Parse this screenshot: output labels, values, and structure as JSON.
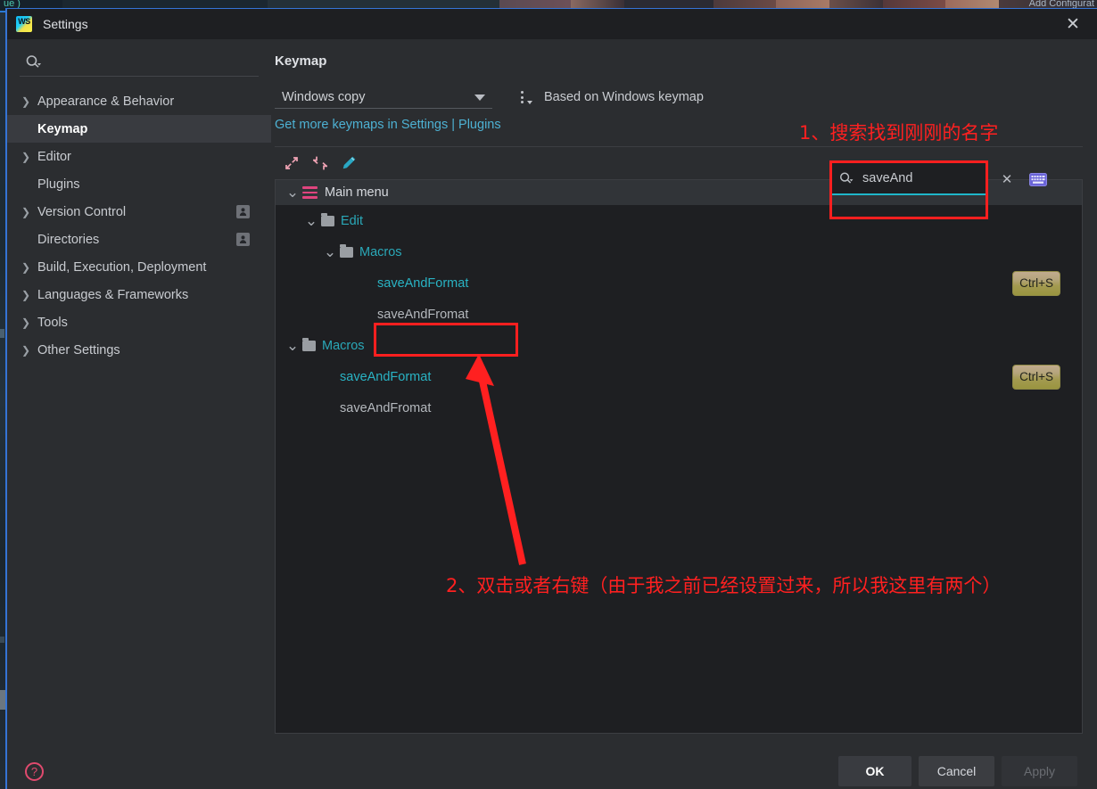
{
  "background": {
    "left_code": "ue )",
    "right_label": "Add Configurat"
  },
  "window": {
    "title": "Settings",
    "app_icon": "webstorm-icon",
    "close_icon": "close-icon"
  },
  "sidebar": {
    "search_icon": "search-icon",
    "search_placeholder": "",
    "items": [
      {
        "label": "Appearance & Behavior",
        "expandable": true,
        "selected": false,
        "badge": false
      },
      {
        "label": "Keymap",
        "expandable": false,
        "selected": true,
        "badge": false
      },
      {
        "label": "Editor",
        "expandable": true,
        "selected": false,
        "badge": false
      },
      {
        "label": "Plugins",
        "expandable": false,
        "selected": false,
        "badge": false
      },
      {
        "label": "Version Control",
        "expandable": true,
        "selected": false,
        "badge": true
      },
      {
        "label": "Directories",
        "expandable": false,
        "selected": false,
        "badge": true
      },
      {
        "label": "Build, Execution, Deployment",
        "expandable": true,
        "selected": false,
        "badge": false
      },
      {
        "label": "Languages & Frameworks",
        "expandable": true,
        "selected": false,
        "badge": false
      },
      {
        "label": "Tools",
        "expandable": true,
        "selected": false,
        "badge": false
      },
      {
        "label": "Other Settings",
        "expandable": true,
        "selected": false,
        "badge": false
      }
    ]
  },
  "content": {
    "page_title": "Keymap",
    "keymap_selected": "Windows copy",
    "kebab_icon": "more-options-icon",
    "based_on": "Based on Windows keymap",
    "get_more_link": "Get more keymaps in Settings | Plugins",
    "toolbar": {
      "expand_all_icon": "expand-all-icon",
      "collapse_all_icon": "collapse-all-icon",
      "edit_icon": "edit-pencil-icon"
    },
    "search": {
      "icon": "search-filter-icon",
      "value": "saveAnd",
      "clear_icon": "clear-x-icon",
      "keyboard_icon": "keyboard-shortcut-icon"
    }
  },
  "tree": {
    "rows": [
      {
        "label": "Main menu",
        "indent": 0,
        "icon": "hamburger-icon",
        "twisty": "down",
        "style": "white",
        "header": true,
        "shortcut": ""
      },
      {
        "label": "Edit",
        "indent": 1,
        "icon": "folder-icon",
        "twisty": "down",
        "style": "cyan",
        "header": false,
        "shortcut": ""
      },
      {
        "label": "Macros",
        "indent": 2,
        "icon": "folder-icon",
        "twisty": "down",
        "style": "cyan",
        "header": false,
        "shortcut": ""
      },
      {
        "label": "saveAndFormat",
        "indent": 4,
        "icon": "none",
        "twisty": "none",
        "style": "cyan-b",
        "header": false,
        "shortcut": "Ctrl+S"
      },
      {
        "label": "saveAndFromat",
        "indent": 4,
        "icon": "none",
        "twisty": "none",
        "style": "gray",
        "header": false,
        "shortcut": ""
      },
      {
        "label": "Macros",
        "indent": 0,
        "icon": "folder-icon",
        "twisty": "down",
        "style": "cyan",
        "header": false,
        "shortcut": ""
      },
      {
        "label": "saveAndFormat",
        "indent": 2,
        "icon": "none",
        "twisty": "none",
        "style": "cyan-b",
        "header": false,
        "shortcut": "Ctrl+S"
      },
      {
        "label": "saveAndFromat",
        "indent": 2,
        "icon": "none",
        "twisty": "none",
        "style": "gray",
        "header": false,
        "shortcut": ""
      }
    ]
  },
  "footer": {
    "help_icon": "help-question-icon",
    "ok_label": "OK",
    "cancel_label": "Cancel",
    "apply_label": "Apply"
  },
  "annotations": {
    "step1_text": "1、搜索找到刚刚的名字",
    "step2_text": "2、双击或者右键（由于我之前已经设置过来，所以我这里有两个）",
    "color": "#ff2020"
  }
}
